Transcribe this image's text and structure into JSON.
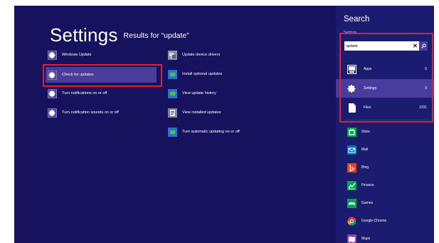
{
  "main": {
    "title": "Settings",
    "results_for": "Results for “update”",
    "results_left": [
      {
        "label": "Windows Update",
        "icon": "gear-icon"
      },
      {
        "label": "Check for updates",
        "icon": "gear-icon"
      },
      {
        "label": "Turn notifications on or off",
        "icon": "gear-icon"
      },
      {
        "label": "Turn notification sounds on or off",
        "icon": "gear-icon"
      }
    ],
    "results_right": [
      {
        "label": "Update device drivers",
        "icon": "device-manager-icon"
      },
      {
        "label": "Install optional updates",
        "icon": "install-updates-icon"
      },
      {
        "label": "View update history",
        "icon": "update-history-icon"
      },
      {
        "label": "View installed updates",
        "icon": "installed-updates-icon"
      },
      {
        "label": "Turn automatic updating on or off",
        "icon": "auto-update-icon"
      }
    ]
  },
  "search_pane": {
    "title": "Search",
    "scope": "Settings",
    "query": "update",
    "clear_glyph": "✕",
    "categories": [
      {
        "label": "Apps",
        "count": "0",
        "icon": "apps-icon"
      },
      {
        "label": "Settings",
        "count": "9",
        "icon": "gear-icon"
      },
      {
        "label": "Files",
        "count": "1291",
        "icon": "files-icon"
      }
    ],
    "apps": [
      {
        "label": "Store",
        "icon": "store-icon"
      },
      {
        "label": "Mail",
        "icon": "mail-icon"
      },
      {
        "label": "Bing",
        "icon": "bing-icon"
      },
      {
        "label": "Finance",
        "icon": "finance-icon"
      },
      {
        "label": "Games",
        "icon": "games-icon"
      },
      {
        "label": "Google Chrome",
        "icon": "chrome-icon"
      },
      {
        "label": "Maps",
        "icon": "maps-icon"
      }
    ]
  },
  "colors": {
    "background": "#17125e",
    "pane": "#1b1b70",
    "selected": "#4a3c9d",
    "highlight": "#d9232e"
  }
}
